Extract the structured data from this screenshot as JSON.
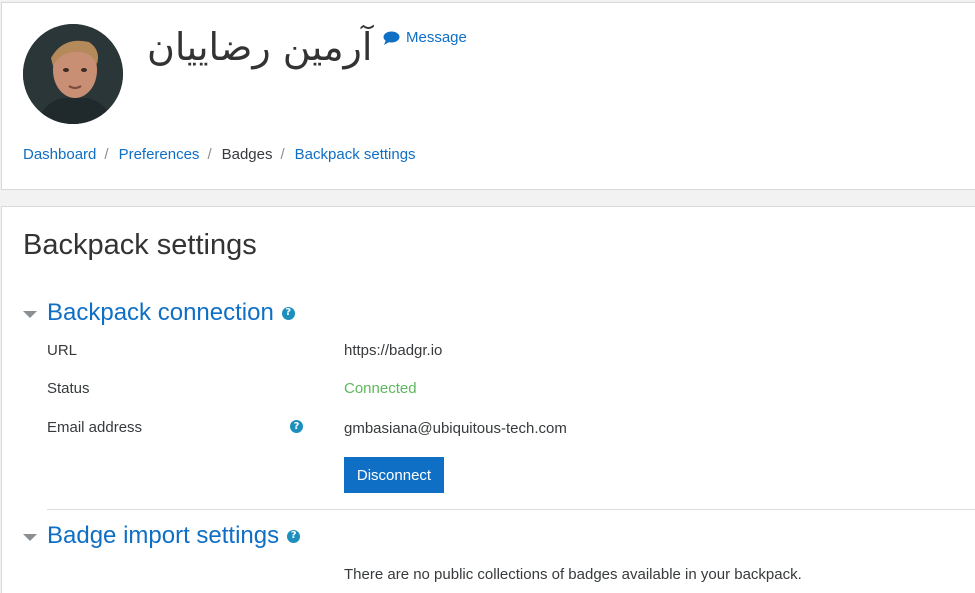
{
  "header": {
    "user_name": "آرمین رضاییان",
    "message_label": "Message",
    "avatar_icon": "user-avatar-photo",
    "message_icon": "speech-bubble-icon"
  },
  "breadcrumb": {
    "items": [
      {
        "label": "Dashboard",
        "link": true
      },
      {
        "label": "Preferences",
        "link": true
      },
      {
        "label": "Badges",
        "link": false
      },
      {
        "label": "Backpack settings",
        "link": true
      }
    ],
    "separator": "/"
  },
  "main": {
    "page_title": "Backpack settings",
    "sections": [
      {
        "title": "Backpack connection",
        "fields": [
          {
            "label": "URL",
            "value": "https://badgr.io"
          },
          {
            "label": "Status",
            "value": "Connected"
          },
          {
            "label": "Email address",
            "value": "gmbasiana@ubiquitous-tech.com"
          }
        ],
        "button_label": "Disconnect"
      },
      {
        "title": "Badge import settings",
        "info_text": "There are no public collections of badges available in your backpack."
      }
    ]
  },
  "colors": {
    "link": "#0f6fc5",
    "button": "#0f6fc5",
    "status_ok": "#5cb85c",
    "help_icon": "#1d8fbe"
  }
}
